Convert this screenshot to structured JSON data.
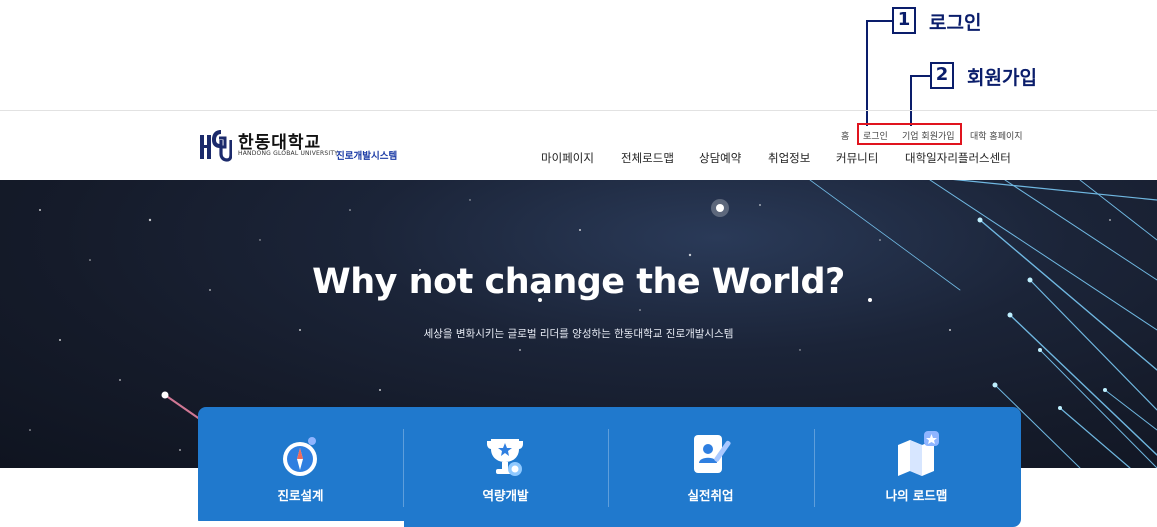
{
  "annotations": [
    {
      "number": "1",
      "label": "로그인"
    },
    {
      "number": "2",
      "label": "회원가입"
    }
  ],
  "logo": {
    "mark": "HGU",
    "korean": "한동대학교",
    "english": "HANDONG GLOBAL UNIVERSITY",
    "system": "진로개발시스템"
  },
  "util_links": [
    "홈",
    "로그인",
    "기업 회원가입",
    "대학 홈페이지"
  ],
  "nav": [
    "마이페이지",
    "전체로드맵",
    "상담예약",
    "취업정보",
    "커뮤니티",
    "대학일자리플러스센터"
  ],
  "hero": {
    "title": "Why not change the World?",
    "subtitle": "세상을 변화시키는 글로벌 리더를 양성하는 한동대학교 진로개발시스템"
  },
  "quick_menu": [
    {
      "label": "진로설계",
      "icon": "compass-icon"
    },
    {
      "label": "역량개발",
      "icon": "trophy-icon"
    },
    {
      "label": "실전취업",
      "icon": "resume-icon"
    },
    {
      "label": "나의 로드맵",
      "icon": "map-icon"
    }
  ],
  "colors": {
    "accent_blue": "#2079cd",
    "annotation_navy": "#0a1d6b",
    "highlight_red": "#e0141e",
    "brand_blue": "#1a3aa5"
  }
}
